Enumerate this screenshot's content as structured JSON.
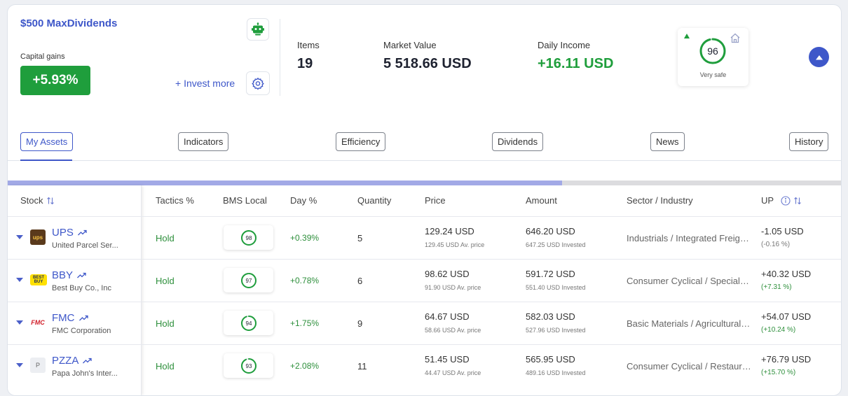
{
  "header": {
    "portfolio_name": "$500 MaxDividends",
    "capital_gains_label": "Capital gains",
    "capital_gains_value": "+5.93%",
    "invest_more_label": "+ Invest more"
  },
  "stats": {
    "items_label": "Items",
    "items_value": "19",
    "market_value_label": "Market Value",
    "market_value": "5 518.66 USD",
    "daily_income_label": "Daily Income",
    "daily_income": "+16.11 USD"
  },
  "safety": {
    "score": "96",
    "score_fraction": 0.96,
    "label": "Very safe"
  },
  "tabs": [
    {
      "label": "My Assets",
      "active": true
    },
    {
      "label": "Indicators"
    },
    {
      "label": "Efficiency"
    },
    {
      "label": "Dividends"
    },
    {
      "label": "News"
    },
    {
      "label": "History"
    }
  ],
  "load_progress": 0.665,
  "columns": {
    "stock": "Stock",
    "tactics": "Tactics %",
    "bms": "BMS Local",
    "day": "Day %",
    "quantity": "Quantity",
    "price": "Price",
    "amount": "Amount",
    "sector": "Sector / Industry",
    "up": "UP"
  },
  "rows": [
    {
      "ticker": "UPS",
      "company": "United Parcel Ser...",
      "logo_text": "ups",
      "logo_bg": "#5a3a1c",
      "logo_color": "#f5c242",
      "tactic": "Hold",
      "bms": "98",
      "bms_fraction": 0.98,
      "day": "+0.39%",
      "quantity": "5",
      "price": "129.24 USD",
      "av_price": "129.45 USD Av. price",
      "amount": "646.20 USD",
      "invested": "647.25 USD Invested",
      "sector": "Industrials / Integrated Freight & Logistics",
      "up": "-1.05 USD",
      "up_pct": "(-0.16 %)",
      "up_positive": false
    },
    {
      "ticker": "BBY",
      "company": "Best Buy Co., Inc",
      "logo_text": "BEST BUY",
      "logo_bg": "#ffe000",
      "logo_color": "#1d2a5b",
      "tactic": "Hold",
      "bms": "97",
      "bms_fraction": 0.97,
      "day": "+0.78%",
      "quantity": "6",
      "price": "98.62 USD",
      "av_price": "91.90 USD Av. price",
      "amount": "591.72 USD",
      "invested": "551.40 USD Invested",
      "sector": "Consumer Cyclical / Specialty Retail",
      "up": "+40.32 USD",
      "up_pct": "(+7.31 %)",
      "up_positive": true
    },
    {
      "ticker": "FMC",
      "company": "FMC Corporation",
      "logo_text": "FMC",
      "logo_bg": "#ffffff",
      "logo_color": "#d11f2a",
      "tactic": "Hold",
      "bms": "94",
      "bms_fraction": 0.94,
      "day": "+1.75%",
      "quantity": "9",
      "price": "64.67 USD",
      "av_price": "58.66 USD Av. price",
      "amount": "582.03 USD",
      "invested": "527.96 USD Invested",
      "sector": "Basic Materials / Agricultural Inputs",
      "up": "+54.07 USD",
      "up_pct": "(+10.24 %)",
      "up_positive": true
    },
    {
      "ticker": "PZZA",
      "company": "Papa John's Inter...",
      "logo_text": "P",
      "logo_bg": "#eceef2",
      "logo_color": "#666666",
      "tactic": "Hold",
      "bms": "93",
      "bms_fraction": 0.93,
      "day": "+2.08%",
      "quantity": "11",
      "price": "51.45 USD",
      "av_price": "44.47 USD Av. price",
      "amount": "565.95 USD",
      "invested": "489.16 USD Invested",
      "sector": "Consumer Cyclical / Restaurants",
      "up": "+76.79 USD",
      "up_pct": "(+15.70 %)",
      "up_positive": true
    }
  ],
  "colors": {
    "accent": "#3e57c9",
    "positive": "#1f9e3c",
    "ring_track": "#dfe3ea"
  }
}
